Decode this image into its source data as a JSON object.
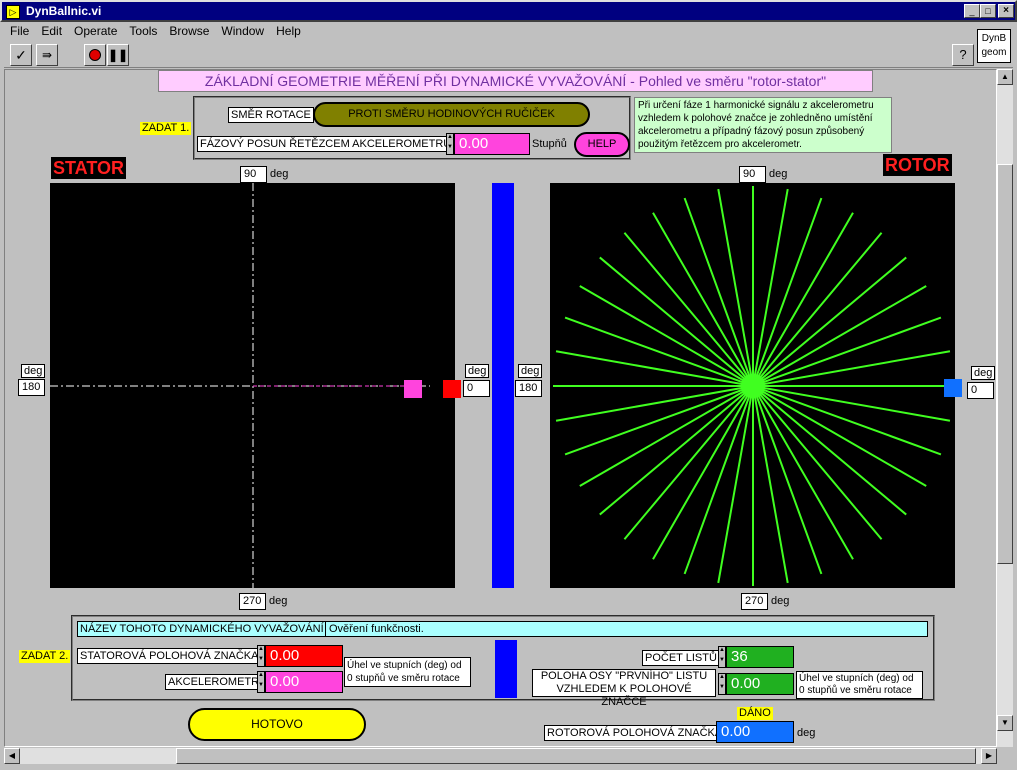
{
  "window": {
    "title": "DynBallnic.vi"
  },
  "menu": [
    "File",
    "Edit",
    "Operate",
    "Tools",
    "Browse",
    "Window",
    "Help"
  ],
  "toolbar": {
    "icon_label_line1": "DynB",
    "icon_label_line2": "geom",
    "help_icon": "?"
  },
  "main_title": "ZÁKLADNÍ GEOMETRIE MĚŘENÍ PŘI DYNAMICKÉ VYVAŽOVÁNÍ - Pohled ve směru \"rotor-stator\"",
  "zadat1": "ZADAT 1.",
  "rotation": {
    "label": "SMĚR ROTACE",
    "value": "PROTI SMĚRU HODINOVÝCH RUČIČEK"
  },
  "phase": {
    "label": "FÁZOVÝ POSUN ŘETĚZCEM AKCELEROMETRU",
    "value": "0.00",
    "unit": "Stupňů",
    "help": "HELP"
  },
  "note": "Při určení fáze 1 harmonické signálu z akcelerometru vzhledem k polohové značce je zohledněno umístění akcelerometru a případný fázový posun způsobený použitým řetězcem pro akcelerometr.",
  "stator": {
    "title": "STATOR",
    "top": "90",
    "bottom": "270",
    "left": "180",
    "right": "0",
    "unit": "deg"
  },
  "rotor": {
    "title": "ROTOR",
    "top": "90",
    "bottom": "270",
    "left": "180",
    "right": "0",
    "unit": "deg"
  },
  "zadat2": "ZADAT 2.",
  "name": {
    "label": "NÁZEV TOHOTO DYNAMICKÉHO VYVAŽOVÁNÍ",
    "value": "Ověření funkčnosti."
  },
  "stator_mark": {
    "label": "STATOROVÁ POLOHOVÁ ZNAČKA",
    "value": "0.00"
  },
  "accel": {
    "label": "AKCELEROMETR",
    "value": "0.00"
  },
  "angle_note_left": [
    "Úhel ve stupních (deg) od",
    "0 stupňů ve směru rotace"
  ],
  "blades": {
    "label": "POČET LISTŮ",
    "value": "36"
  },
  "axis": {
    "label_line1": "POLOHA OSY \"PRVNÍHO\" LISTU",
    "label_line2": "VZHLEDEM K POLOHOVÉ ZNAČCE",
    "value": "0.00"
  },
  "angle_note_right": [
    "Úhel ve stupních (deg) od",
    "0 stupňů ve směru rotace"
  ],
  "done_button": "HOTOVO",
  "given": {
    "label": "DÁNO"
  },
  "rotor_mark": {
    "label": "ROTOROVÁ POLOHOVÁ ZNAČKA",
    "value": "0.00",
    "unit": "deg"
  },
  "colors": {
    "stator_mark": "#ff0000",
    "accel": "#ff33cc",
    "blade": "#40ff20",
    "rotor_mark": "#1070ff",
    "blue_bar": "#0000ff",
    "title_bg": "#000080"
  }
}
